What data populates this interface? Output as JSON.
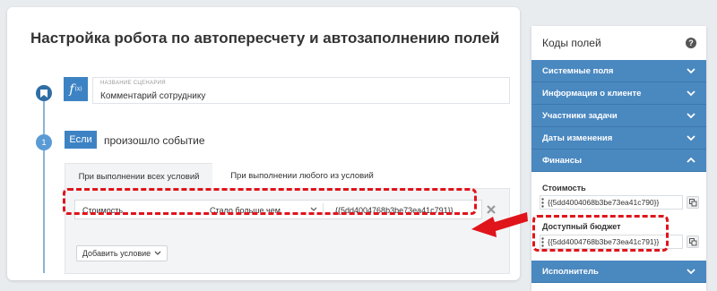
{
  "page": {
    "title": "Настройка робота по автопересчету и автозаполнению полей"
  },
  "steps": {
    "step1_icon": "bookmark-icon",
    "step2_number": "1"
  },
  "scenario": {
    "icon_text": "f",
    "icon_sub": "(x)",
    "label": "НАЗВАНИЕ СЦЕНАРИЯ",
    "value": "Комментарий сотруднику"
  },
  "event": {
    "if_label": "Если",
    "text": "произошло событие"
  },
  "tabs": [
    {
      "label": "При выполнении всех условий",
      "active": true
    },
    {
      "label": "При выполнении любого из условий",
      "active": false
    }
  ],
  "condition": {
    "field": "Стоимость",
    "operator": "Стало больше чем",
    "value": "{{5dd4004768b3be73ea41c791}}"
  },
  "add_condition": {
    "label": "Добавить условие"
  },
  "side_panel": {
    "title": "Коды полей",
    "help_icon": "?",
    "sections": [
      {
        "label": "Системные поля",
        "expanded": false
      },
      {
        "label": "Информация о клиенте",
        "expanded": false
      },
      {
        "label": "Участники задачи",
        "expanded": false
      },
      {
        "label": "Даты изменения",
        "expanded": false
      },
      {
        "label": "Финансы",
        "expanded": true
      },
      {
        "label": "Исполнитель",
        "expanded": false
      }
    ],
    "finance_fields": [
      {
        "label": "Стоимость",
        "code": "{{5dd4004068b3be73ea41c790}}"
      },
      {
        "label": "Доступный бюджет",
        "code": "{{5dd4004768b3be73ea41c791}}"
      }
    ]
  },
  "colors": {
    "accent": "#3d83c4",
    "accordion": "#4a88c0",
    "highlight": "#e0141b"
  }
}
